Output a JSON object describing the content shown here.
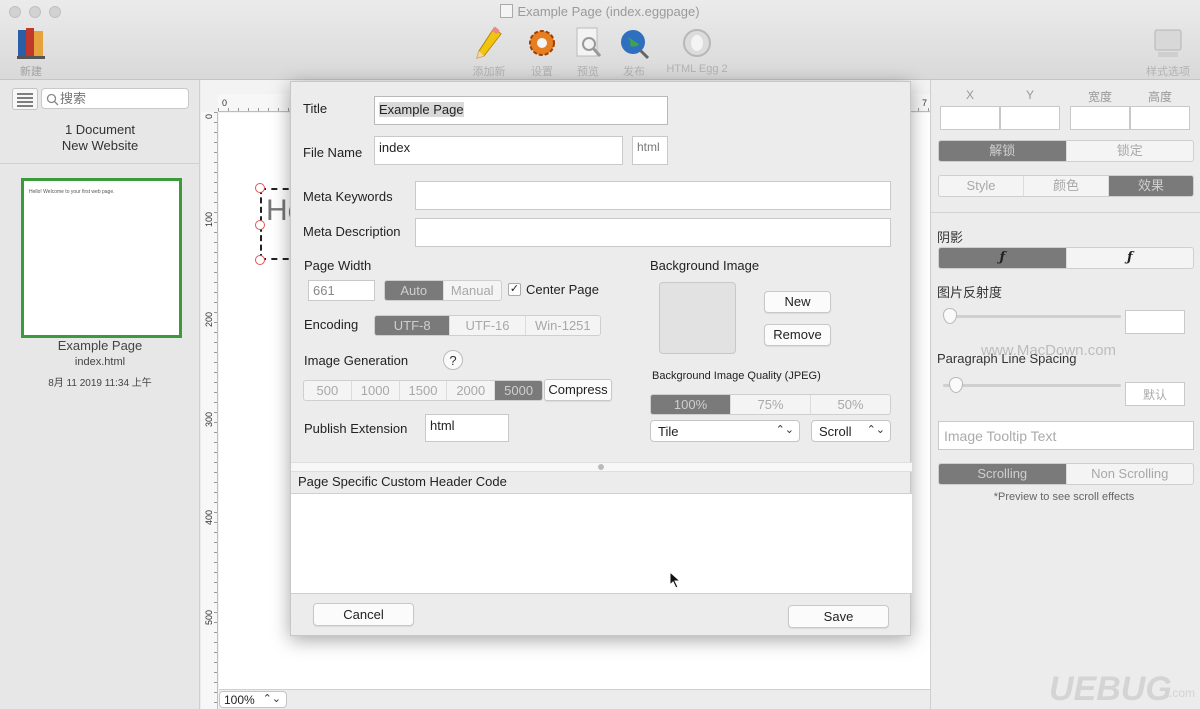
{
  "window": {
    "title": "Example Page (index.eggpage)"
  },
  "toolbar": {
    "new_label": "新建",
    "add_label": "添加新",
    "settings_label": "设置",
    "preview_label": "预览",
    "publish_label": "发布",
    "html_egg_label": "HTML Egg 2",
    "style_options_label": "样式选项"
  },
  "sidebar": {
    "search_placeholder": "搜索",
    "doc_count": "1 Document",
    "website_name": "New Website",
    "page": {
      "thumb_text": "Hello!  Welcome to your first web page.",
      "name": "Example Page",
      "file": "index.html",
      "date": "8月 11 2019 11:34 上午"
    }
  },
  "canvas": {
    "zoom": "100%",
    "element_text": "He",
    "ruler_h": [
      "0",
      "7"
    ],
    "ruler_v": [
      "0",
      "100",
      "200",
      "300",
      "400",
      "500"
    ]
  },
  "dialog": {
    "title_label": "Title",
    "title_value": "Example Page",
    "filename_label": "File Name",
    "filename_value": "index",
    "filename_ext": "html",
    "meta_keywords_label": "Meta Keywords",
    "meta_keywords_value": "",
    "meta_description_label": "Meta Description",
    "meta_description_value": "",
    "page_width_label": "Page Width",
    "page_width_value": "661",
    "width_modes": [
      "Auto",
      "Manual"
    ],
    "center_page_label": "Center Page",
    "center_page_checkmark": "✓",
    "encoding_label": "Encoding",
    "encodings": [
      "UTF-8",
      "UTF-16",
      "Win-1251"
    ],
    "image_generation_label": "Image Generation",
    "help_glyph": "?",
    "image_sizes": [
      "500",
      "1000",
      "1500",
      "2000",
      "5000"
    ],
    "compress_label": "Compress",
    "publish_extension_label": "Publish Extension",
    "publish_extension_value": "html",
    "background_image_label": "Background Image",
    "new_label": "New",
    "remove_label": "Remove",
    "bg_quality_label": "Background Image Quality (JPEG)",
    "qualities": [
      "100%",
      "75%",
      "50%"
    ],
    "tile_value": "Tile",
    "scroll_value": "Scroll",
    "custom_header_label": "Page Specific Custom Header Code",
    "custom_header_value": "",
    "cancel_label": "Cancel",
    "save_label": "Save"
  },
  "inspector": {
    "x_label": "X",
    "y_label": "Y",
    "width_label": "宽度",
    "height_label": "高度",
    "lock_modes": [
      "解锁",
      "锁定"
    ],
    "tabs": [
      "Style",
      "颜色",
      "效果"
    ],
    "shadow_label": "阴影",
    "shadow_fx": [
      "ƒ",
      "ƒ"
    ],
    "reflectivity_label": "图片反射度",
    "line_spacing_label": "Paragraph Line Spacing",
    "line_spacing_value": "默认",
    "tooltip_placeholder": "Image Tooltip Text",
    "scroll_modes": [
      "Scrolling",
      "Non Scrolling"
    ],
    "scroll_note": "*Preview to see scroll effects"
  },
  "watermarks": {
    "macdown": "www.MacDown.com",
    "uebug": "UEBUG",
    "uebug_sub": ".com"
  }
}
